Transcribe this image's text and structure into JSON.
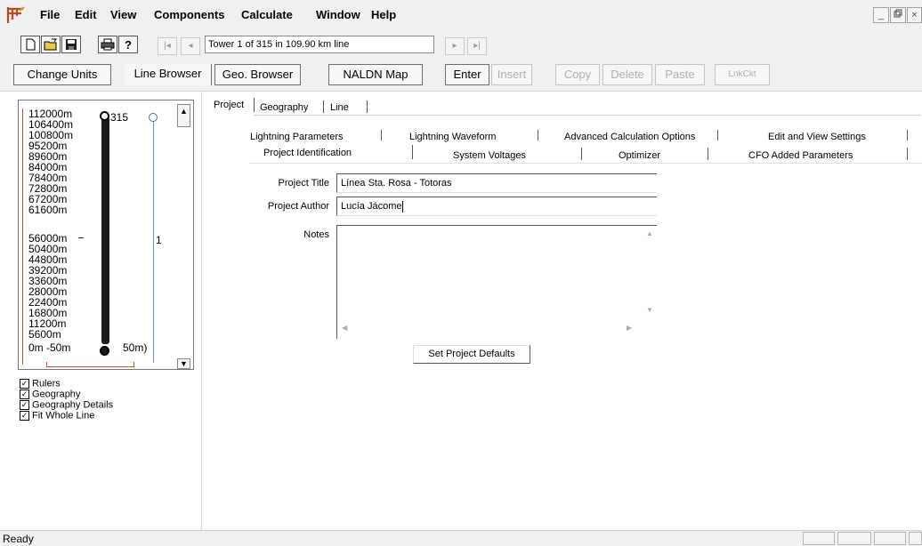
{
  "menu": [
    "File",
    "Edit",
    "View",
    "Components",
    "Calculate",
    "Window",
    "Help"
  ],
  "window_controls": [
    "_",
    "×"
  ],
  "toolbar1": {
    "icons": [
      "new-file-icon",
      "open-folder-icon",
      "save-disk-icon",
      "print-icon",
      "help-icon"
    ],
    "nav": [
      "|◂",
      "◂",
      "▸",
      "▸|"
    ],
    "tower_display": "Tower 1 of 315 in 109.90 km line"
  },
  "toolbar2": {
    "change_units": "Change Units",
    "line_browser": "Line Browser",
    "geo_browser": "Geo. Browser",
    "naldn_map": "NALDN Map",
    "enter": "Enter",
    "insert": "Insert",
    "copy": "Copy",
    "delete": "Delete",
    "paste": "Paste",
    "linkckt": "LnkCkt"
  },
  "tower_view": {
    "scale": [
      "112000m",
      "106400m",
      "100800m",
      "95200m",
      "89600m",
      "84000m",
      "78400m",
      "72800m",
      "67200m",
      "61600m",
      "56000m",
      "50400m",
      "44800m",
      "39200m",
      "33600m",
      "28000m",
      "22400m",
      "16800m",
      "11200m",
      "5600m"
    ],
    "bottom_left": "0m -50m",
    "bottom_right": "50m)",
    "tower_count": "315",
    "marker": "1"
  },
  "checkboxes": [
    {
      "label": "Rulers",
      "checked": true
    },
    {
      "label": "Geography",
      "checked": true
    },
    {
      "label": "Geography Details",
      "checked": true
    },
    {
      "label": "Fit Whole Line",
      "checked": true
    }
  ],
  "top_tabs": [
    "Project",
    "Geography",
    "Line"
  ],
  "sub_tabs_row1": [
    "Lightning Parameters",
    "Lightning Waveform",
    "Advanced Calculation Options",
    "Edit and View Settings"
  ],
  "sub_tabs_row2": [
    "Project Identification",
    "System Voltages",
    "Optimizer",
    "CFO Added Parameters"
  ],
  "form": {
    "title_label": "Project Title",
    "title_value": "Línea Sta. Rosa - Totoras",
    "author_label": "Project Author",
    "author_value": "Lucía Jácome",
    "notes_label": "Notes",
    "notes_value": "",
    "defaults_button": "Set Project Defaults"
  },
  "status": "Ready"
}
